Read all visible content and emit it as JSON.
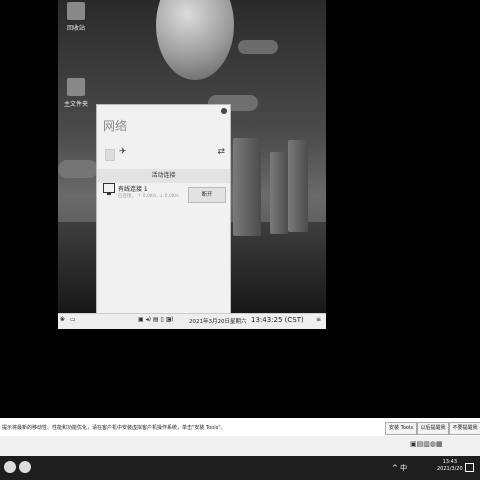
{
  "desktop": {
    "icons": [
      {
        "label": "回收站",
        "icon": "trash-icon"
      },
      {
        "label": "主文件夹",
        "icon": "home-folder-icon"
      }
    ]
  },
  "network_panel": {
    "title": "网络",
    "section_header": "活动连接",
    "connection": {
      "name": "有线连接 1",
      "status": "已连接，  ↑ 0.0K/s,  ↓ 0.0K/s",
      "button": "断开"
    }
  },
  "vm_taskbar": {
    "date": "2021年3月20日星期六",
    "time": "13:43:25 (CST)"
  },
  "notice_bar": {
    "text": "提示将最新的移动性、性能和功能优化，请在客户机中安装虚拟客户机操作系统，单击\"安装 Tools\"。",
    "buttons": [
      "安装 Tools",
      "以后提醒我",
      "不要提醒我"
    ]
  },
  "host_taskbar": {
    "time": "13:43",
    "date": "2021/3/20",
    "tray_text": "^ 中"
  }
}
